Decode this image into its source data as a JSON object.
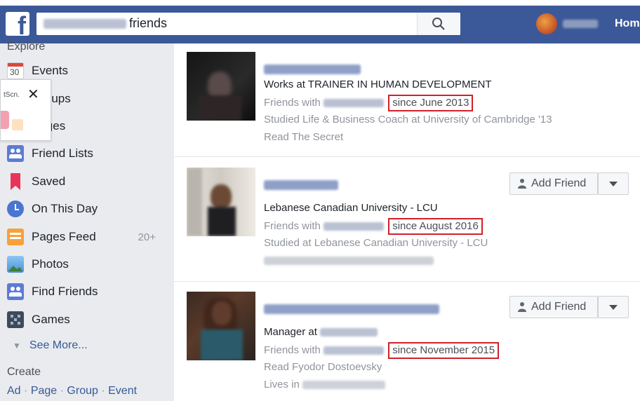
{
  "search": {
    "prefix_blurred": "Iyad Bukarie's",
    "query": "friends"
  },
  "header": {
    "home_label": "Hom"
  },
  "sidebar": {
    "explore_heading": "Explore",
    "items": [
      {
        "label": "Events",
        "icon": "calendar-icon",
        "count": "",
        "date": "30"
      },
      {
        "label": "Groups",
        "icon": "groups-icon",
        "count": ""
      },
      {
        "label": "Pages",
        "icon": "pages-icon",
        "count": ""
      },
      {
        "label": "Friend Lists",
        "icon": "friend-lists-icon",
        "count": ""
      },
      {
        "label": "Saved",
        "icon": "bookmark-icon",
        "count": ""
      },
      {
        "label": "On This Day",
        "icon": "clock-icon",
        "count": ""
      },
      {
        "label": "Pages Feed",
        "icon": "pages-feed-icon",
        "count": "20+"
      },
      {
        "label": "Photos",
        "icon": "photos-icon",
        "count": ""
      },
      {
        "label": "Find Friends",
        "icon": "find-friends-icon",
        "count": ""
      },
      {
        "label": "Games",
        "icon": "games-icon",
        "count": ""
      }
    ],
    "see_more": "See More...",
    "create_heading": "Create",
    "create_links": [
      "Ad",
      "Page",
      "Group",
      "Event"
    ]
  },
  "popup": {
    "badge_text": "tScn."
  },
  "friends": [
    {
      "line1": "Works at TRAINER IN HUMAN DEVELOPMENT",
      "friends_prefix": "Friends with",
      "since": "since June 2013",
      "line3": "Studied Life & Business Coach at University of Cambridge '13",
      "line4": "Read The Secret",
      "has_add_button": false
    },
    {
      "line1": "Lebanese Canadian University - LCU",
      "friends_prefix": "Friends with",
      "since": "since August 2016",
      "line3": "Studied at Lebanese Canadian University - LCU",
      "line4": "",
      "has_add_button": true
    },
    {
      "line1": "Manager at",
      "friends_prefix": "Friends with",
      "since": "since November 2015",
      "line3": "Read Fyodor Dostoevsky",
      "line4": "Lives in",
      "has_add_button": true
    }
  ],
  "buttons": {
    "add_friend_label": "Add Friend"
  },
  "colors": {
    "brand_blue": "#3b5998",
    "highlight_red": "#d0202a",
    "link_blue": "#365899"
  }
}
